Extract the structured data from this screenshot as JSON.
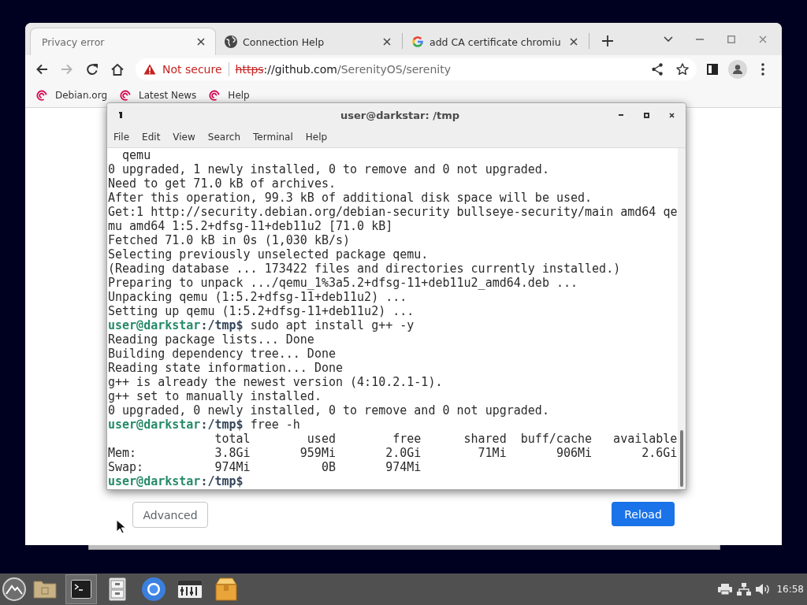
{
  "browser": {
    "tabs": [
      {
        "kind": "error",
        "title": "Privacy error",
        "selected": true
      },
      {
        "kind": "page",
        "title": "Connection Help",
        "selected": false
      },
      {
        "kind": "search",
        "title": "add CA certificate chromiu",
        "selected": false
      }
    ],
    "nav_buttons": [
      {
        "kind": "back",
        "disabled": false
      },
      {
        "kind": "forward",
        "disabled": true
      },
      {
        "kind": "reload",
        "disabled": false
      },
      {
        "kind": "home",
        "disabled": false
      }
    ],
    "address_bar": {
      "security_label": "Not secure",
      "scheme": "https",
      "host": "://github.com",
      "path": "/SerenityOS/serenity"
    },
    "bookmarks": [
      "Debian.org",
      "Latest News",
      "Help"
    ],
    "page_buttons": [
      {
        "kind": "secondary",
        "label": "Advanced"
      },
      {
        "kind": "primary",
        "label": "Reload"
      }
    ]
  },
  "terminal": {
    "title": "user@darkstar: /tmp",
    "menu": [
      "File",
      "Edit",
      "View",
      "Search",
      "Terminal",
      "Help"
    ],
    "lines": [
      {
        "kind": "indented",
        "text": "qemu"
      },
      {
        "kind": "output",
        "text": "0 upgraded, 1 newly installed, 0 to remove and 0 not upgraded."
      },
      {
        "kind": "output",
        "text": "Need to get 71.0 kB of archives."
      },
      {
        "kind": "output",
        "text": "After this operation, 99.3 kB of additional disk space will be used."
      },
      {
        "kind": "output",
        "text": "Get:1 http://security.debian.org/debian-security bullseye-security/main amd64 qe"
      },
      {
        "kind": "output",
        "text": "mu amd64 1:5.2+dfsg-11+deb11u2 [71.0 kB]"
      },
      {
        "kind": "output",
        "text": "Fetched 71.0 kB in 0s (1,030 kB/s)"
      },
      {
        "kind": "output",
        "text": "Selecting previously unselected package qemu."
      },
      {
        "kind": "output",
        "text": "(Reading database ... 173422 files and directories currently installed.)"
      },
      {
        "kind": "output",
        "text": "Preparing to unpack .../qemu_1%3a5.2+dfsg-11+deb11u2_amd64.deb ..."
      },
      {
        "kind": "output",
        "text": "Unpacking qemu (1:5.2+dfsg-11+deb11u2) ..."
      },
      {
        "kind": "output",
        "text": "Setting up qemu (1:5.2+dfsg-11+deb11u2) ..."
      },
      {
        "kind": "prompt",
        "user_host": "user@darkstar",
        "path": ":/tmp$",
        "command": "sudo apt install g++ -y"
      },
      {
        "kind": "output",
        "text": "Reading package lists... Done"
      },
      {
        "kind": "output",
        "text": "Building dependency tree... Done"
      },
      {
        "kind": "output",
        "text": "Reading state information... Done"
      },
      {
        "kind": "output",
        "text": "g++ is already the newest version (4:10.2.1-1)."
      },
      {
        "kind": "output",
        "text": "g++ set to manually installed."
      },
      {
        "kind": "output",
        "text": "0 upgraded, 0 newly installed, 0 to remove and 0 not upgraded."
      },
      {
        "kind": "prompt",
        "user_host": "user@darkstar",
        "path": ":/tmp$",
        "command": "free -h"
      },
      {
        "kind": "columns",
        "cells": [
          "total",
          "used",
          "free",
          "shared",
          "buff/cache",
          "available"
        ]
      },
      {
        "kind": "row",
        "label": "Mem:",
        "cells": [
          "3.8Gi",
          "959Mi",
          "2.0Gi",
          "71Mi",
          "906Mi",
          "2.6Gi"
        ]
      },
      {
        "kind": "row",
        "label": "Swap:",
        "cells": [
          "974Mi",
          "0B",
          "974Mi"
        ]
      },
      {
        "kind": "prompt",
        "user_host": "user@darkstar",
        "path": ":/tmp$"
      }
    ]
  },
  "taskbar": {
    "apps": [
      {
        "kind": "files",
        "selected": false
      },
      {
        "kind": "terminal",
        "selected": true
      },
      {
        "kind": "cabinet",
        "selected": false
      },
      {
        "kind": "browser",
        "selected": false
      },
      {
        "kind": "mixer",
        "selected": false
      },
      {
        "kind": "package",
        "selected": false
      }
    ],
    "clock": "16:58"
  }
}
